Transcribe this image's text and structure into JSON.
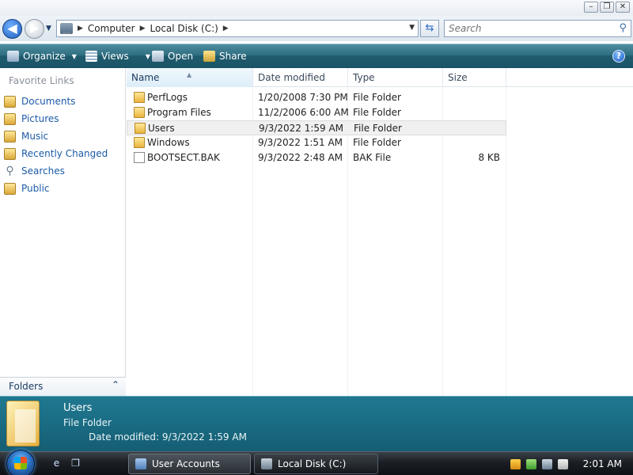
{
  "window": {
    "controls": [
      "–",
      "❐",
      "✕"
    ]
  },
  "address": {
    "breadcrumbs": [
      "Computer",
      "Local Disk (C:)"
    ],
    "search_placeholder": "Search"
  },
  "toolbar": {
    "organize": "Organize",
    "views": "Views",
    "open": "Open",
    "share": "Share",
    "help": "?"
  },
  "sidebar": {
    "heading": "Favorite Links",
    "items": [
      {
        "label": "Documents",
        "icon": "documents-icon"
      },
      {
        "label": "Pictures",
        "icon": "pictures-icon"
      },
      {
        "label": "Music",
        "icon": "music-icon"
      },
      {
        "label": "Recently Changed",
        "icon": "recently-changed-icon"
      },
      {
        "label": "Searches",
        "icon": "search-icon"
      },
      {
        "label": "Public",
        "icon": "public-folder-icon"
      }
    ],
    "folders_label": "Folders"
  },
  "columns": {
    "name": "Name",
    "date": "Date modified",
    "type": "Type",
    "size": "Size"
  },
  "files": [
    {
      "name": "PerfLogs",
      "date": "1/20/2008 7:30 PM",
      "type": "File Folder",
      "size": "",
      "icon": "folder-icon"
    },
    {
      "name": "Program Files",
      "date": "11/2/2006 6:00 AM",
      "type": "File Folder",
      "size": "",
      "icon": "folder-icon"
    },
    {
      "name": "Users",
      "date": "9/3/2022 1:59 AM",
      "type": "File Folder",
      "size": "",
      "icon": "folder-icon",
      "selected": true
    },
    {
      "name": "Windows",
      "date": "9/3/2022 1:51 AM",
      "type": "File Folder",
      "size": "",
      "icon": "folder-icon"
    },
    {
      "name": "BOOTSECT.BAK",
      "date": "9/3/2022 2:48 AM",
      "type": "BAK File",
      "size": "8 KB",
      "icon": "file-icon"
    }
  ],
  "details": {
    "title": "Users",
    "type": "File Folder",
    "modified": "Date modified: 9/3/2022 1:59 AM"
  },
  "taskbar": {
    "tasks": [
      {
        "label": "User Accounts",
        "icon": "user-accounts-icon"
      },
      {
        "label": "Local Disk (C:)",
        "icon": "local-disk-icon"
      }
    ],
    "clock": "2:01 AM"
  },
  "colors": {
    "toolbar": "#1f5b6e",
    "link": "#1c5ba8",
    "details": "#1b6f86"
  }
}
